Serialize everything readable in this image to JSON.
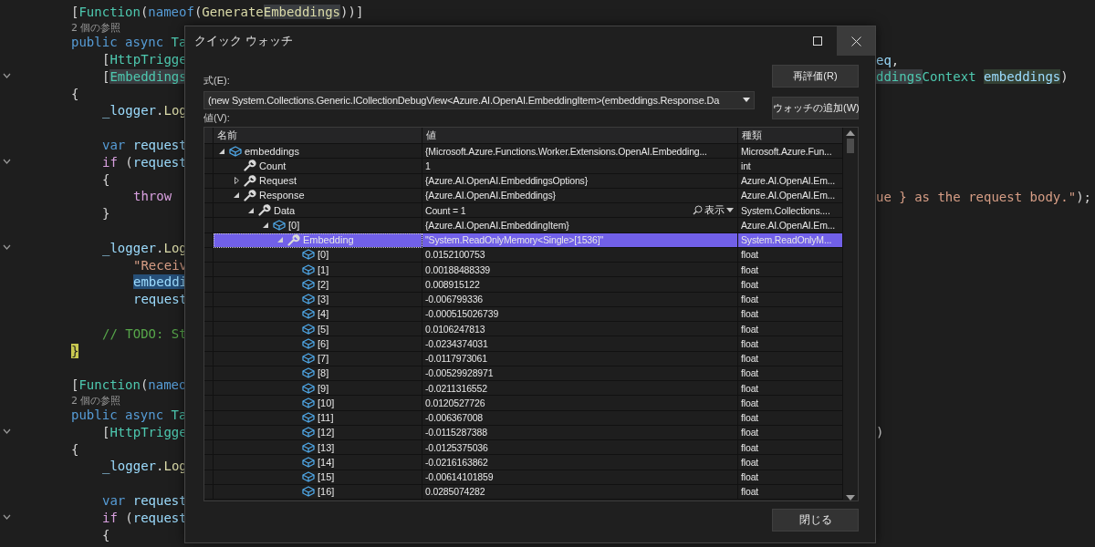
{
  "editor": {
    "lines": [
      {
        "tokens": [
          {
            "text": "[",
            "kind": "punct"
          },
          {
            "text": "Function",
            "kind": "type"
          },
          {
            "text": "(",
            "kind": "punct"
          },
          {
            "text": "nameof",
            "kind": "keyword"
          },
          {
            "text": "(",
            "kind": "punct"
          },
          {
            "text": "Generate",
            "kind": "method"
          },
          {
            "text": "Embeddings",
            "kind": "method",
            "highlighted": true
          },
          {
            "text": "))]",
            "kind": "punct"
          }
        ]
      },
      {
        "kind": "codelens",
        "tokens": [
          {
            "text": "2 個の参照",
            "kind": "codelens"
          }
        ]
      },
      {
        "tokens": [
          {
            "text": "public async ",
            "kind": "keyword"
          },
          {
            "text": "Ta",
            "kind": "type"
          }
        ],
        "children": [
          {
            "tokens": [
              {
                "text": "[",
                "kind": "punct"
              },
              {
                "text": "HttpTrigge",
                "kind": "type"
              }
            ],
            "right": [
              {
                "text": "eq",
                "kind": "plain"
              },
              {
                "text": ",",
                "kind": "punct"
              }
            ]
          },
          {
            "fold_marker": true,
            "tokens": [
              {
                "text": "[",
                "kind": "punct"
              },
              {
                "text": "Embeddings",
                "kind": "type",
                "highlighted": true
              }
            ],
            "right": [
              {
                "text": "ddings",
                "kind": "type",
                "highlighted": true
              },
              {
                "text": "Context ",
                "kind": "type"
              },
              {
                "text": "embeddings",
                "kind": "plain",
                "highlighted": true
              },
              {
                "text": ")",
                "kind": "punct"
              }
            ]
          }
        ]
      },
      {
        "tokens": [
          {
            "text": "{",
            "kind": "punct"
          }
        ],
        "children": [
          {
            "tokens": [
              {
                "text": "_logger",
                "kind": "plain"
              },
              {
                "text": ".",
                "kind": "punct"
              },
              {
                "text": "Log",
                "kind": "method"
              }
            ]
          },
          {
            "kind": "blank"
          },
          {
            "tokens": [
              {
                "text": "var ",
                "kind": "keyword"
              },
              {
                "text": "request",
                "kind": "plain"
              }
            ]
          },
          {
            "fold_marker": true,
            "tokens": [
              {
                "text": "if",
                "kind": "control"
              },
              {
                "text": " (",
                "kind": "punct"
              },
              {
                "text": "request",
                "kind": "plain"
              }
            ]
          },
          {
            "tokens": [
              {
                "text": "{",
                "kind": "punct"
              }
            ],
            "children": [
              {
                "tokens": [
                  {
                    "text": "throw",
                    "kind": "control"
                  }
                ],
                "right": [
                  {
                    "text": "ue } as the request body.\"",
                    "kind": "string"
                  },
                  {
                    "text": ");",
                    "kind": "punct"
                  }
                ]
              }
            ]
          },
          {
            "tokens": [
              {
                "text": "}",
                "kind": "punct"
              }
            ]
          },
          {
            "kind": "blank"
          },
          {
            "fold_marker": true,
            "tokens": [
              {
                "text": "_logger",
                "kind": "plain"
              },
              {
                "text": ".",
                "kind": "punct"
              },
              {
                "text": "Log",
                "kind": "method"
              }
            ],
            "children": [
              {
                "tokens": [
                  {
                    "text": "\"Receiv",
                    "kind": "string"
                  }
                ]
              },
              {
                "tokens": [
                  {
                    "text": "embeddi",
                    "kind": "plain",
                    "selected": true
                  }
                ]
              },
              {
                "tokens": [
                  {
                    "text": "request",
                    "kind": "plain"
                  }
                ]
              }
            ]
          },
          {
            "kind": "blank"
          },
          {
            "tokens": [
              {
                "text": "// TODO: St",
                "kind": "comment"
              }
            ]
          }
        ]
      },
      {
        "tokens": [
          {
            "text": "}",
            "kind": "punct",
            "highlighted": true
          }
        ]
      },
      {
        "kind": "blank"
      },
      {
        "tokens": [
          {
            "text": "[",
            "kind": "punct"
          },
          {
            "text": "Function",
            "kind": "type"
          },
          {
            "text": "(",
            "kind": "punct"
          },
          {
            "text": "nameo",
            "kind": "keyword"
          }
        ]
      },
      {
        "kind": "codelens",
        "tokens": [
          {
            "text": "2 個の参照",
            "kind": "codelens"
          }
        ]
      },
      {
        "tokens": [
          {
            "text": "public async ",
            "kind": "keyword"
          },
          {
            "text": "Ta",
            "kind": "type"
          }
        ],
        "children": [
          {
            "fold_marker": true,
            "tokens": [
              {
                "text": "[",
                "kind": "punct"
              },
              {
                "text": "HttpTrigge",
                "kind": "type"
              }
            ],
            "right": [
              {
                "text": ")",
                "kind": "punct"
              }
            ]
          }
        ]
      },
      {
        "tokens": [
          {
            "text": "{",
            "kind": "punct"
          }
        ],
        "children": [
          {
            "tokens": [
              {
                "text": "_logger",
                "kind": "plain"
              },
              {
                "text": ".",
                "kind": "punct"
              },
              {
                "text": "Log",
                "kind": "method"
              }
            ]
          },
          {
            "kind": "blank"
          },
          {
            "tokens": [
              {
                "text": "var ",
                "kind": "keyword"
              },
              {
                "text": "request",
                "kind": "plain"
              }
            ]
          },
          {
            "fold_marker": true,
            "tokens": [
              {
                "text": "if",
                "kind": "control"
              },
              {
                "text": " (",
                "kind": "punct"
              },
              {
                "text": "request",
                "kind": "plain"
              }
            ]
          },
          {
            "tokens": [
              {
                "text": "{",
                "kind": "punct"
              }
            ]
          }
        ]
      }
    ]
  },
  "dialog": {
    "title": "クイック ウォッチ",
    "expression_label": "式(E):",
    "expression": "(new System.Collections.Generic.ICollectionDebugView<Azure.AI.OpenAI.EmbeddingItem>(embeddings.Response.Da",
    "value_label": "値(V):",
    "buttons": [
      "再評価(R)",
      "ウォッチの追加(W)"
    ],
    "close_button": "閉じる",
    "columns": [
      "名前",
      "値",
      "種類"
    ],
    "rows": [
      {
        "name": "embeddings",
        "kind": "object",
        "expanded": true,
        "selected": false,
        "value": "{Microsoft.Azure.Functions.Worker.Extensions.OpenAI.Embedding...",
        "type": "Microsoft.Azure.Fun...",
        "children": [
          {
            "name": "Count",
            "kind": "property",
            "selected": false,
            "value": "1",
            "type": "int"
          },
          {
            "name": "Request",
            "kind": "property",
            "expanded": false,
            "selected": false,
            "value": "{Azure.AI.OpenAI.EmbeddingsOptions}",
            "type": "Azure.AI.OpenAI.Em..."
          },
          {
            "name": "Response",
            "kind": "property",
            "expanded": true,
            "selected": false,
            "value": "{Azure.AI.OpenAI.Embeddings}",
            "type": "Azure.AI.OpenAI.Em...",
            "children": [
              {
                "name": "Data",
                "kind": "property",
                "expanded": true,
                "selected": false,
                "value": "Count = 1",
                "visualizer": "表示",
                "type": "System.Collections....",
                "children": [
                  {
                    "name": "[0]",
                    "kind": "object",
                    "expanded": true,
                    "selected": false,
                    "value": "{Azure.AI.OpenAI.EmbeddingItem}",
                    "type": "Azure.AI.OpenAI.Em...",
                    "children": [
                      {
                        "name": "Embedding",
                        "kind": "property",
                        "expanded": true,
                        "selected": true,
                        "value": "\"System.ReadOnlyMemory<Single>[1536]\"",
                        "type": "System.ReadOnlyM...",
                        "children": [
                          {
                            "name": "[0]",
                            "kind": "object",
                            "selected": false,
                            "value": "0.0152100753",
                            "type": "float"
                          },
                          {
                            "name": "[1]",
                            "kind": "object",
                            "selected": false,
                            "value": "0.00188488339",
                            "type": "float"
                          },
                          {
                            "name": "[2]",
                            "kind": "object",
                            "selected": false,
                            "value": "0.008915122",
                            "type": "float"
                          },
                          {
                            "name": "[3]",
                            "kind": "object",
                            "selected": false,
                            "value": "-0.006799336",
                            "type": "float"
                          },
                          {
                            "name": "[4]",
                            "kind": "object",
                            "selected": false,
                            "value": "-0.000515026739",
                            "type": "float"
                          },
                          {
                            "name": "[5]",
                            "kind": "object",
                            "selected": false,
                            "value": "0.0106247813",
                            "type": "float"
                          },
                          {
                            "name": "[6]",
                            "kind": "object",
                            "selected": false,
                            "value": "-0.0234374031",
                            "type": "float"
                          },
                          {
                            "name": "[7]",
                            "kind": "object",
                            "selected": false,
                            "value": "-0.0117973061",
                            "type": "float"
                          },
                          {
                            "name": "[8]",
                            "kind": "object",
                            "selected": false,
                            "value": "-0.00529928971",
                            "type": "float"
                          },
                          {
                            "name": "[9]",
                            "kind": "object",
                            "selected": false,
                            "value": "-0.0211316552",
                            "type": "float"
                          },
                          {
                            "name": "[10]",
                            "kind": "object",
                            "selected": false,
                            "value": "0.0120527726",
                            "type": "float"
                          },
                          {
                            "name": "[11]",
                            "kind": "object",
                            "selected": false,
                            "value": "-0.006367008",
                            "type": "float"
                          },
                          {
                            "name": "[12]",
                            "kind": "object",
                            "selected": false,
                            "value": "-0.0115287388",
                            "type": "float"
                          },
                          {
                            "name": "[13]",
                            "kind": "object",
                            "selected": false,
                            "value": "-0.0125375036",
                            "type": "float"
                          },
                          {
                            "name": "[14]",
                            "kind": "object",
                            "selected": false,
                            "value": "-0.0216163862",
                            "type": "float"
                          },
                          {
                            "name": "[15]",
                            "kind": "object",
                            "selected": false,
                            "value": "-0.00614101859",
                            "type": "float"
                          },
                          {
                            "name": "[16]",
                            "kind": "object",
                            "selected": false,
                            "value": "0.0285074282",
                            "type": "float"
                          }
                        ]
                      }
                    ]
                  }
                ]
              }
            ]
          }
        ]
      }
    ]
  }
}
